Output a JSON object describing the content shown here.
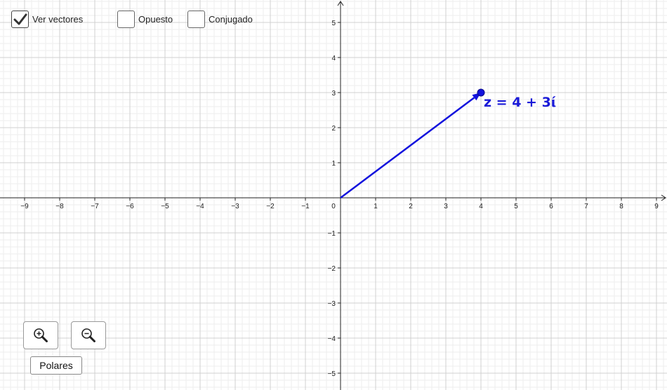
{
  "checkboxes": [
    {
      "label": "Ver vectores",
      "checked": true
    },
    {
      "label": "Opuesto",
      "checked": false
    },
    {
      "label": "Conjugado",
      "checked": false
    }
  ],
  "buttons": {
    "zoom_in_icon": "zoom-in-icon",
    "zoom_out_icon": "zoom-out-icon",
    "polares_label": "Polares"
  },
  "graph": {
    "x_range": [
      -9,
      9
    ],
    "y_range": [
      -5,
      5
    ],
    "x_tick_labels": [
      "−9",
      "−8",
      "−7",
      "−6",
      "−5",
      "−4",
      "−3",
      "−2",
      "−1",
      "0",
      "1",
      "2",
      "3",
      "4",
      "5",
      "6",
      "7",
      "8",
      "9"
    ],
    "y_tick_labels": [
      "5",
      "4",
      "3",
      "2",
      "1",
      "−1",
      "−2",
      "−3",
      "−4",
      "−5"
    ],
    "grid": true,
    "point": {
      "x": 4,
      "y": 3,
      "label": "z = 4 + 3ί"
    },
    "vector_color": "#1111dd",
    "label_color": "#1a1ad8",
    "grid_major_color": "#d0d0d0",
    "grid_minor_color": "#eeeeee"
  }
}
